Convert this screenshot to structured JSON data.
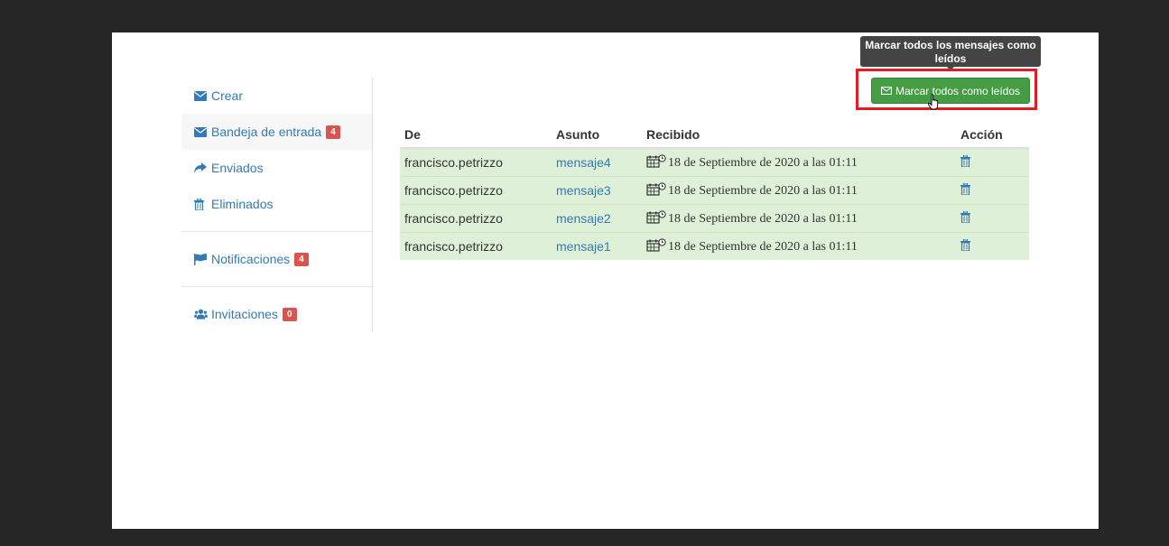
{
  "sidebar": {
    "items": [
      {
        "label": "Crear",
        "icon": "envelope-icon"
      },
      {
        "label": "Bandeja de entrada",
        "icon": "envelope-icon",
        "badge": "4"
      },
      {
        "label": "Enviados",
        "icon": "share-icon"
      },
      {
        "label": "Eliminados",
        "icon": "trash-icon"
      },
      {
        "label": "Notificaciones",
        "icon": "flag-icon",
        "badge": "4"
      },
      {
        "label": "Invitaciones",
        "icon": "users-icon",
        "badge": "0"
      }
    ]
  },
  "toolbar": {
    "mark_all_label": "Marcar todos como leídos",
    "tooltip": "Marcar todos los mensajes como leídos"
  },
  "table": {
    "headers": [
      "De",
      "Asunto",
      "Recibido",
      "Acción"
    ],
    "rows": [
      {
        "from": "francisco.petrizzo",
        "subject": "mensaje4",
        "received": "18 de Septiembre de 2020 a las 01:11"
      },
      {
        "from": "francisco.petrizzo",
        "subject": "mensaje3",
        "received": "18 de Septiembre de 2020 a las 01:11"
      },
      {
        "from": "francisco.petrizzo",
        "subject": "mensaje2",
        "received": "18 de Septiembre de 2020 a las 01:11"
      },
      {
        "from": "francisco.petrizzo",
        "subject": "mensaje1",
        "received": "18 de Septiembre de 2020 a las 01:11"
      }
    ]
  },
  "colors": {
    "link": "#337ab7",
    "success": "#449d44",
    "row_bg": "#dff0d8",
    "badge": "#d9534f",
    "highlight": "#e31b23"
  }
}
